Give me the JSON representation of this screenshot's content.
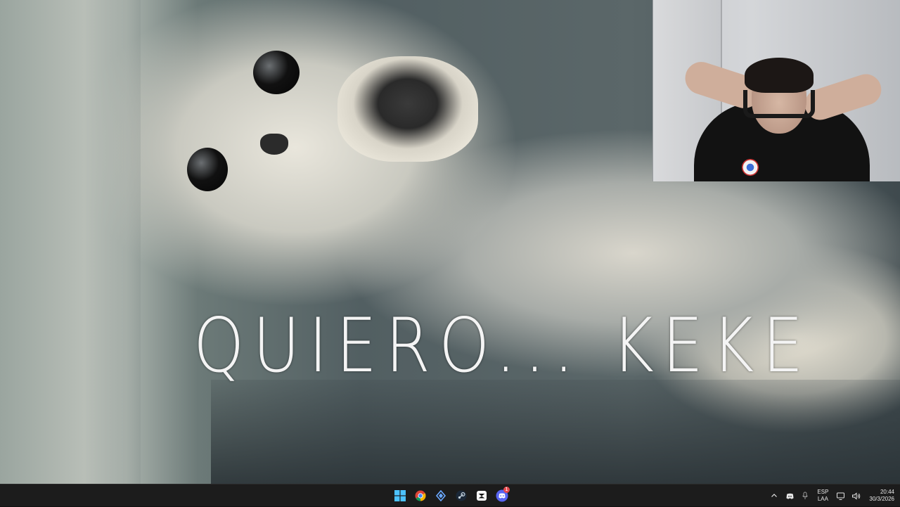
{
  "meme": {
    "caption": "QUIERO... KEKE"
  },
  "webcam": {
    "label": ""
  },
  "taskbar": {
    "apps": [
      {
        "name": "windows-start",
        "icon": "windows-logo-icon"
      },
      {
        "name": "chrome",
        "icon": "chrome-icon"
      },
      {
        "name": "app-diamond",
        "icon": "diamond-app-icon"
      },
      {
        "name": "steam",
        "icon": "steam-icon"
      },
      {
        "name": "capcut",
        "icon": "capcut-icon"
      },
      {
        "name": "discord",
        "icon": "discord-icon",
        "badge": "1"
      }
    ],
    "tray": {
      "language_line1": "ESP",
      "language_line2": "LAA",
      "time": "20:44",
      "date": "30/3/2026"
    }
  },
  "colors": {
    "taskbar_bg": "#1c1c1c",
    "windows_blue": "#4cc2ff",
    "badge_red": "#e5484d"
  }
}
